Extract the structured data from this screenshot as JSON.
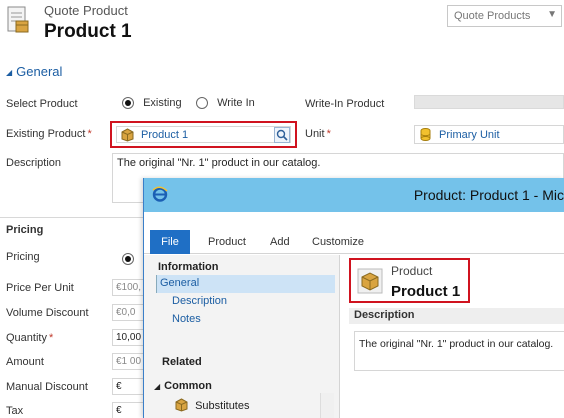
{
  "header": {
    "entity_type": "Quote Product",
    "record_title": "Product 1",
    "form_selector": "Quote Products"
  },
  "general": {
    "section_title": "General",
    "select_product_label": "Select Product",
    "existing_radio_label": "Existing",
    "writein_radio_label": "Write In",
    "writein_product_label": "Write-In Product",
    "existing_product_label": "Existing Product",
    "existing_product_value": "Product 1",
    "unit_label": "Unit",
    "unit_value": "Primary Unit",
    "description_label": "Description",
    "description_value": "The original \"Nr. 1\" product in our catalog."
  },
  "pricing": {
    "section_title": "Pricing",
    "fields": [
      {
        "label": "Pricing",
        "value": ""
      },
      {
        "label": "Price Per Unit",
        "value": "€100,"
      },
      {
        "label": "Volume Discount",
        "value": "€0,0"
      },
      {
        "label": "Quantity",
        "value": "10,00"
      },
      {
        "label": "Amount",
        "value": "€1 00"
      },
      {
        "label": "Manual Discount",
        "value": "€"
      },
      {
        "label": "Tax",
        "value": "€"
      }
    ]
  },
  "popup": {
    "window_title": "Product: Product 1 - Mic",
    "ribbon_tabs": [
      "File",
      "Product",
      "Add",
      "Customize"
    ],
    "nav": {
      "information_heading": "Information",
      "information_items": [
        "General",
        "Description",
        "Notes"
      ],
      "related_heading": "Related",
      "common_heading": "Common",
      "common_items": [
        "Substitutes"
      ]
    },
    "entity_type": "Product",
    "record_title": "Product 1",
    "description_label": "Description",
    "description_value": "The original \"Nr. 1\" product in our catalog."
  },
  "colors": {
    "accent": "#1c5ea3",
    "required": "#c0392b",
    "highlight_border": "#d0131f",
    "titlebar": "#74c2ea",
    "file_tab": "#1f6fc5"
  }
}
